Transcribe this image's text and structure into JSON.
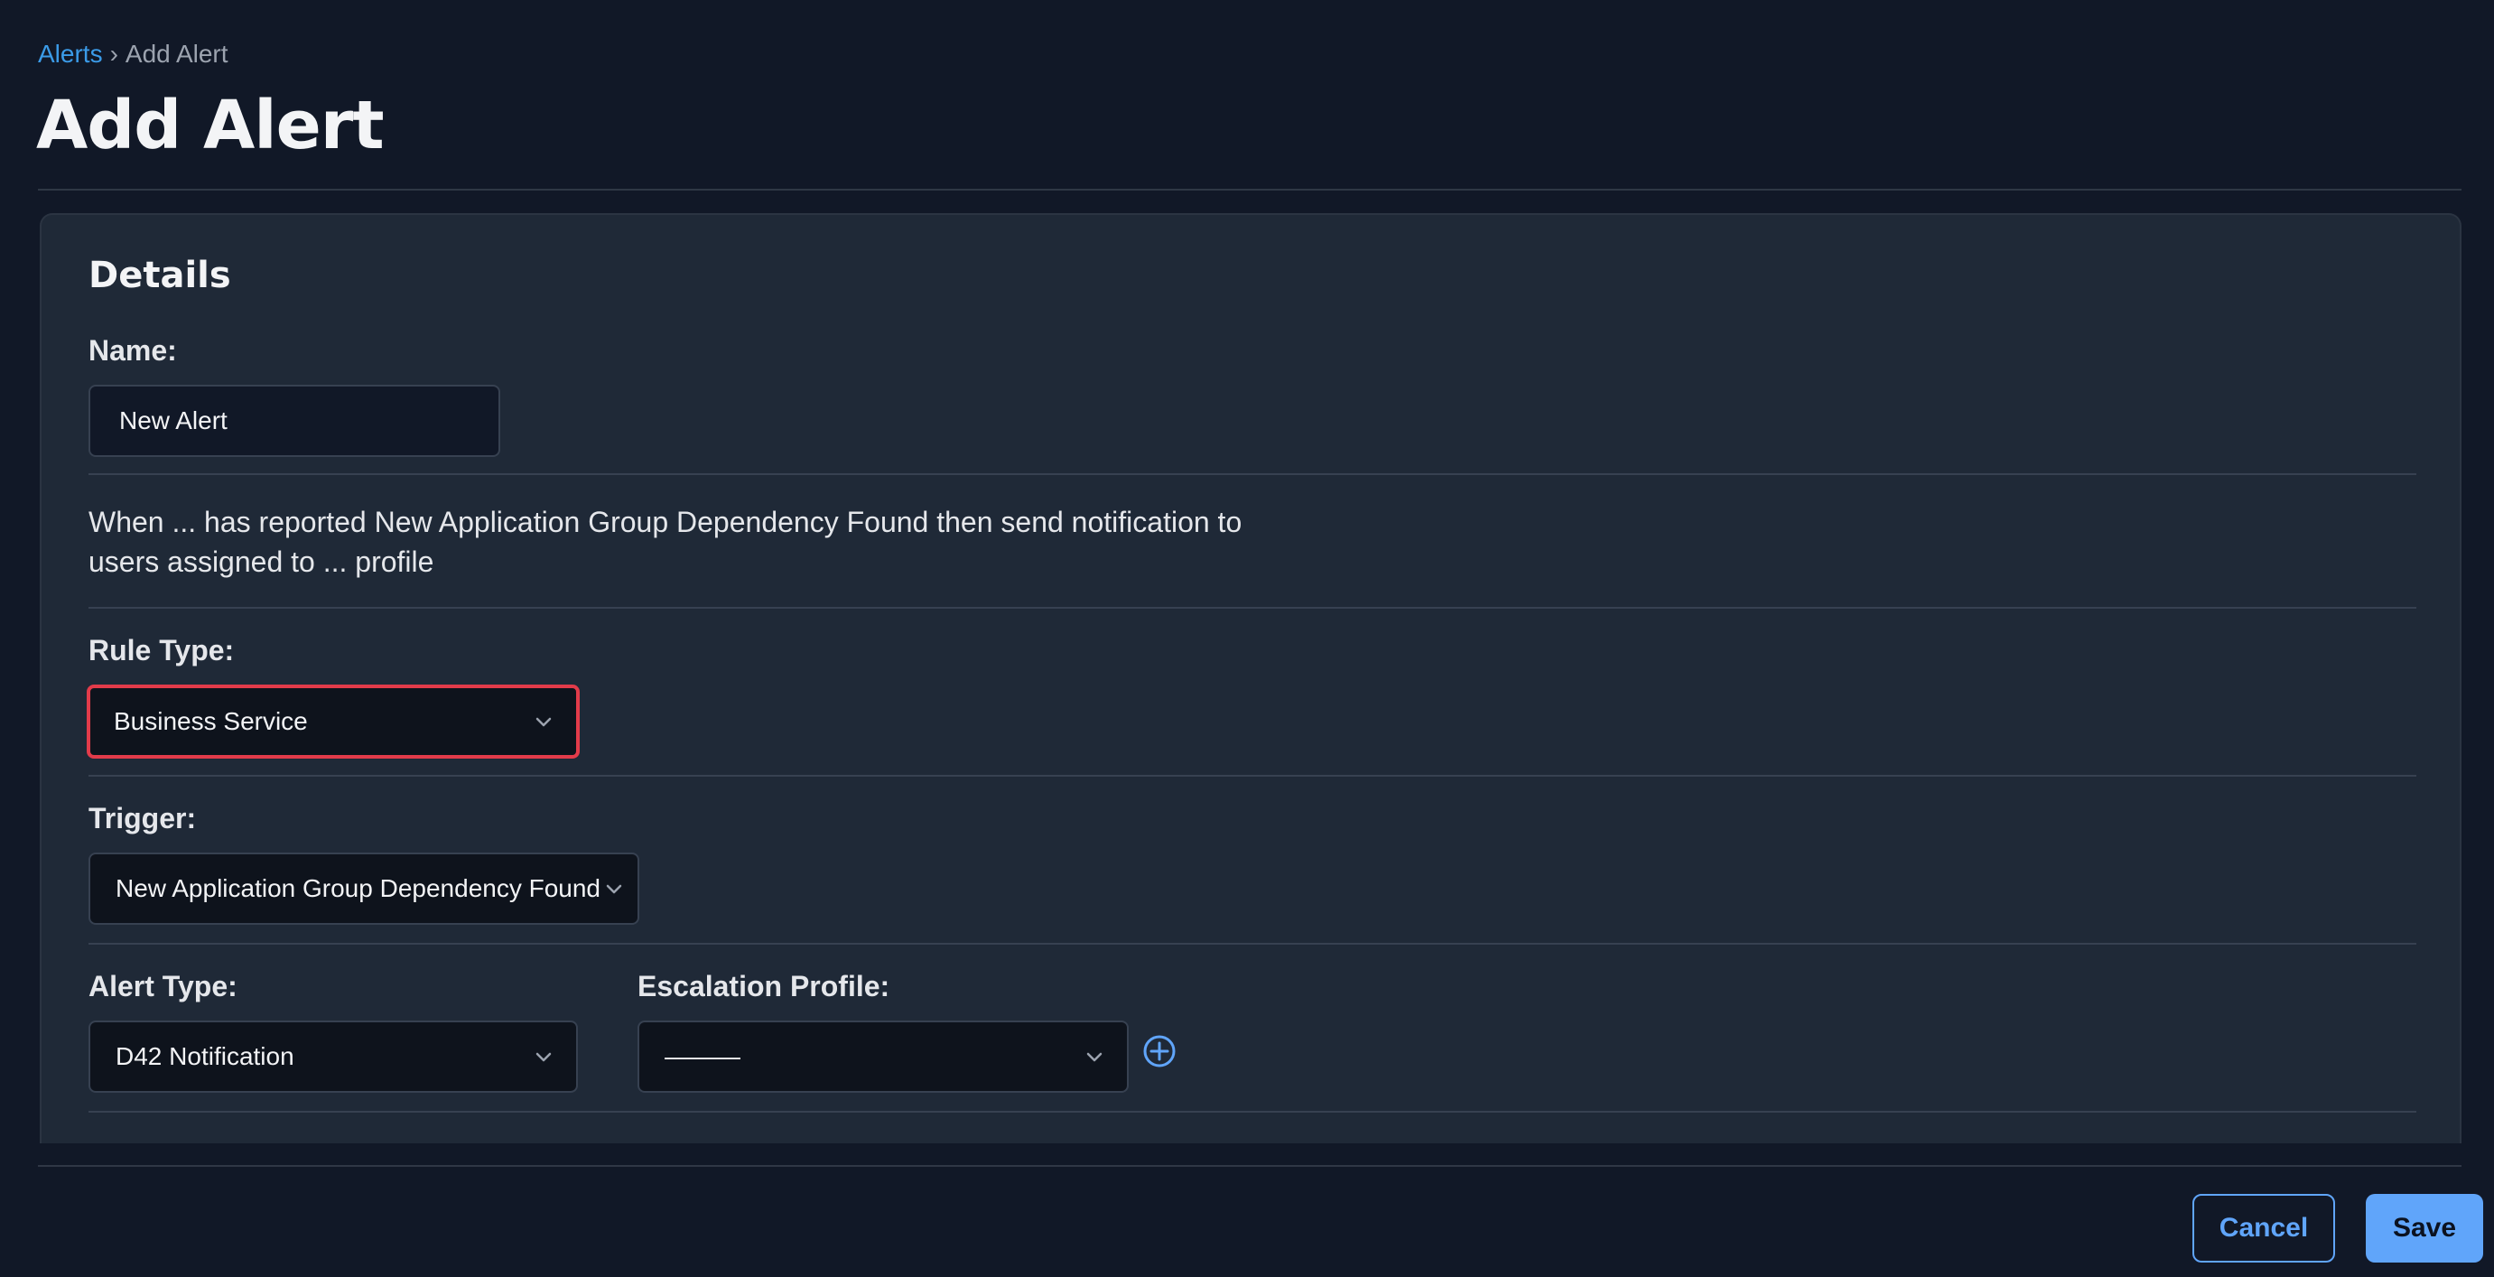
{
  "breadcrumb": {
    "parent": "Alerts",
    "separator": "›",
    "current": "Add Alert"
  },
  "page_title": "Add Alert",
  "details": {
    "section_title": "Details",
    "name": {
      "label": "Name:",
      "value": "New Alert"
    },
    "description": "When ... has reported New Application Group Dependency Found then send notification to users assigned to ... profile",
    "rule_type": {
      "label": "Rule Type:",
      "value": "Business Service"
    },
    "trigger": {
      "label": "Trigger:",
      "value": "New Application Group Dependency Found"
    },
    "alert_type": {
      "label": "Alert Type:",
      "value": "D42 Notification"
    },
    "escalation_profile": {
      "label": "Escalation Profile:",
      "value": "———"
    }
  },
  "footer": {
    "cancel_label": "Cancel",
    "save_label": "Save"
  },
  "colors": {
    "background": "#111827",
    "panel": "#1f2937",
    "accent": "#60a5fa",
    "link": "#3b9be8",
    "highlight": "#e23b4a"
  },
  "icons": {
    "dropdown": "chevron-down-icon",
    "add": "plus-circle-icon"
  }
}
